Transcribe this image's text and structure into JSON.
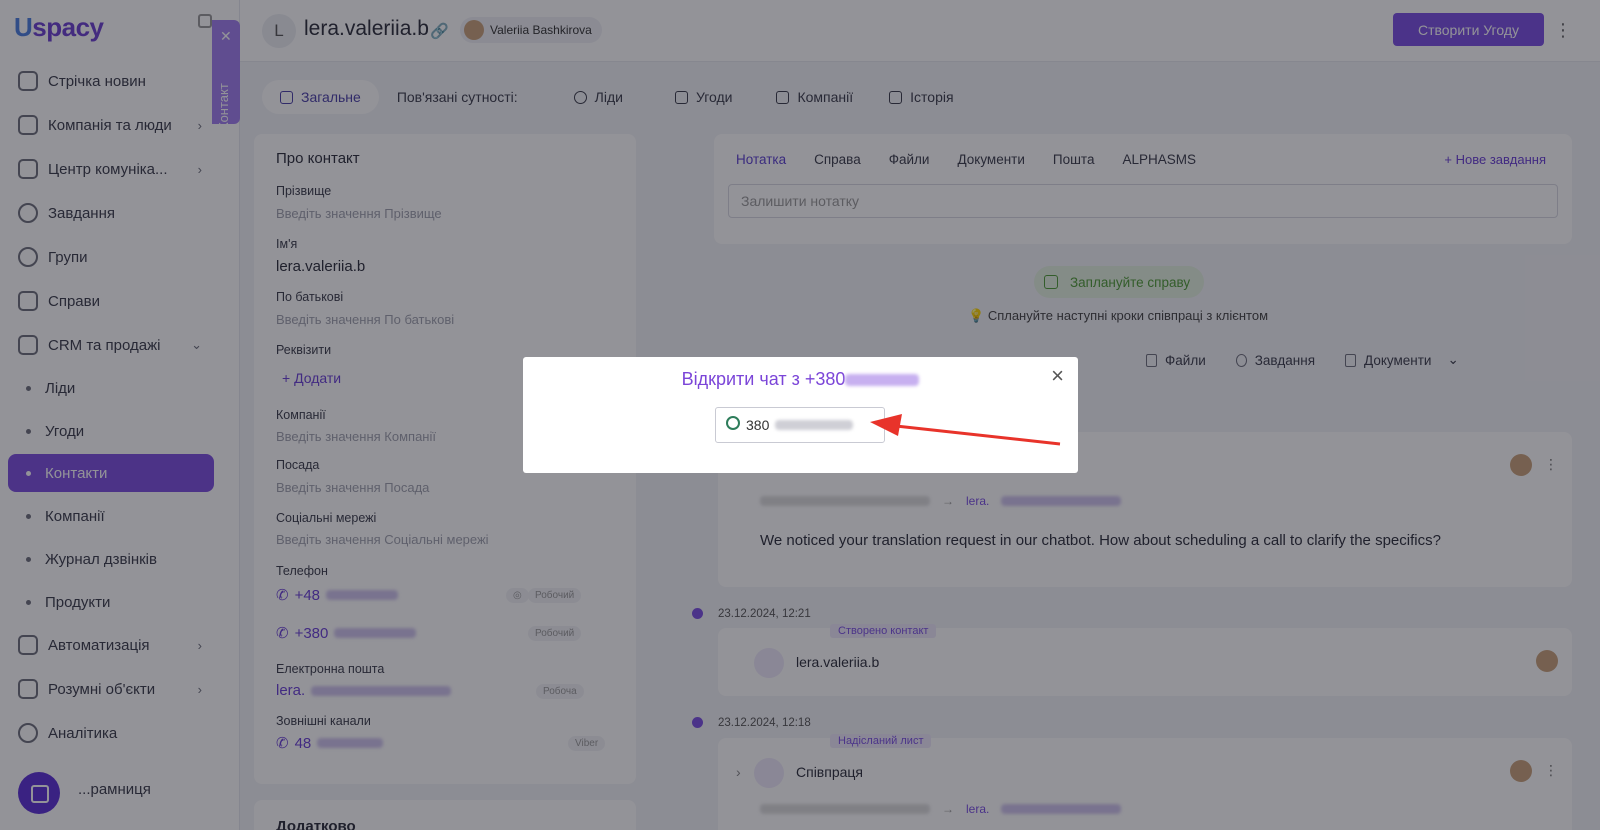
{
  "app": {
    "logo_text": "spacy",
    "logo_prefix": "U"
  },
  "sidebar": {
    "items": [
      {
        "label": "Стрічка новин"
      },
      {
        "label": "Компанія та люди",
        "has_children": true
      },
      {
        "label": "Центр комуніка...",
        "has_children": true
      },
      {
        "label": "Завдання"
      },
      {
        "label": "Групи"
      },
      {
        "label": "Справи"
      },
      {
        "label": "CRM та продажі",
        "has_children": true,
        "expanded": true
      }
    ],
    "crm_subitems": [
      {
        "label": "Ліди"
      },
      {
        "label": "Угоди"
      },
      {
        "label": "Контакти",
        "active": true
      },
      {
        "label": "Компанії"
      },
      {
        "label": "Журнал дзвінків"
      },
      {
        "label": "Продукти"
      }
    ],
    "items_bottom": [
      {
        "label": "Автоматизація",
        "has_children": true
      },
      {
        "label": "Розумні об'єкти",
        "has_children": true
      },
      {
        "label": "Аналітика"
      },
      {
        "label": "...рамниця"
      }
    ],
    "contact_tab_label": "Контакт"
  },
  "header": {
    "avatar_letter": "L",
    "title": "lera.valeriia.b",
    "owner_name": "Valeriia Bashkirova",
    "create_button": "Створити Угоду"
  },
  "tabs": [
    {
      "label": "Загальне",
      "active": true
    },
    {
      "label": "Пов'язані сутності:",
      "static": true
    },
    {
      "label": "Ліди"
    },
    {
      "label": "Угоди"
    },
    {
      "label": "Компанії"
    },
    {
      "label": "Історія"
    }
  ],
  "about": {
    "heading": "Про контакт",
    "surname_label": "Прізвище",
    "surname_placeholder": "Введіть значення Прізвище",
    "name_label": "Ім'я",
    "name_value": "lera.valeriia.b",
    "patronymic_label": "По батькові",
    "patronymic_placeholder": "Введіть значення По батькові",
    "requisites_label": "Реквізити",
    "add_label": "Додати",
    "companies_label": "Компанії",
    "companies_placeholder": "Введіть значення Компанії",
    "position_label": "Посада",
    "position_placeholder": "Введіть значення Посада",
    "social_label": "Соціальні мережі",
    "social_placeholder": "Введіть значення Соціальні мережі",
    "phone_label": "Телефон",
    "phone1_prefix": "+48",
    "phone1_tag": "Робочий",
    "phone2_prefix": "+380",
    "phone2_tag": "Робочий",
    "email_label": "Електронна пошта",
    "email_prefix": "lera.",
    "email_tag": "Робоча",
    "external_label": "Зовнішні канали",
    "external_prefix": "48",
    "external_tag": "Viber",
    "extra_heading": "Додатково"
  },
  "note_panel": {
    "tabs": [
      "Нотатка",
      "Справа",
      "Файли",
      "Документи",
      "Пошта",
      "ALPHASMS"
    ],
    "new_task": "Нове завдання",
    "input_placeholder": "Залишити нотатку"
  },
  "plan": {
    "button": "Заплануйте справу",
    "hint": "Сплануйте наступні кроки співпраці з клієнтом"
  },
  "filters": [
    "Файли",
    "Завдання",
    "Документи"
  ],
  "feed": {
    "message_text": "We noticed your translation request in our chatbot. How about scheduling a call to clarify the specifics?",
    "email_to_prefix": "lera.",
    "event1_date": "23.12.2024, 12:21",
    "event1_badge": "Створено контакт",
    "event1_name": "lera.valeriia.b",
    "event2_date": "23.12.2024, 12:18",
    "event2_badge": "Надісланий лист",
    "event2_subject": "Співпраця",
    "event2_to_prefix": "lera."
  },
  "modal": {
    "title": "Відкрити чат з +380",
    "chat_button_prefix": "380",
    "close": "×"
  },
  "colors": {
    "accent": "#7a4fe3",
    "modal_title": "#7b45d8",
    "arrow": "#e8332a",
    "plan_green": "#4f9b36"
  }
}
